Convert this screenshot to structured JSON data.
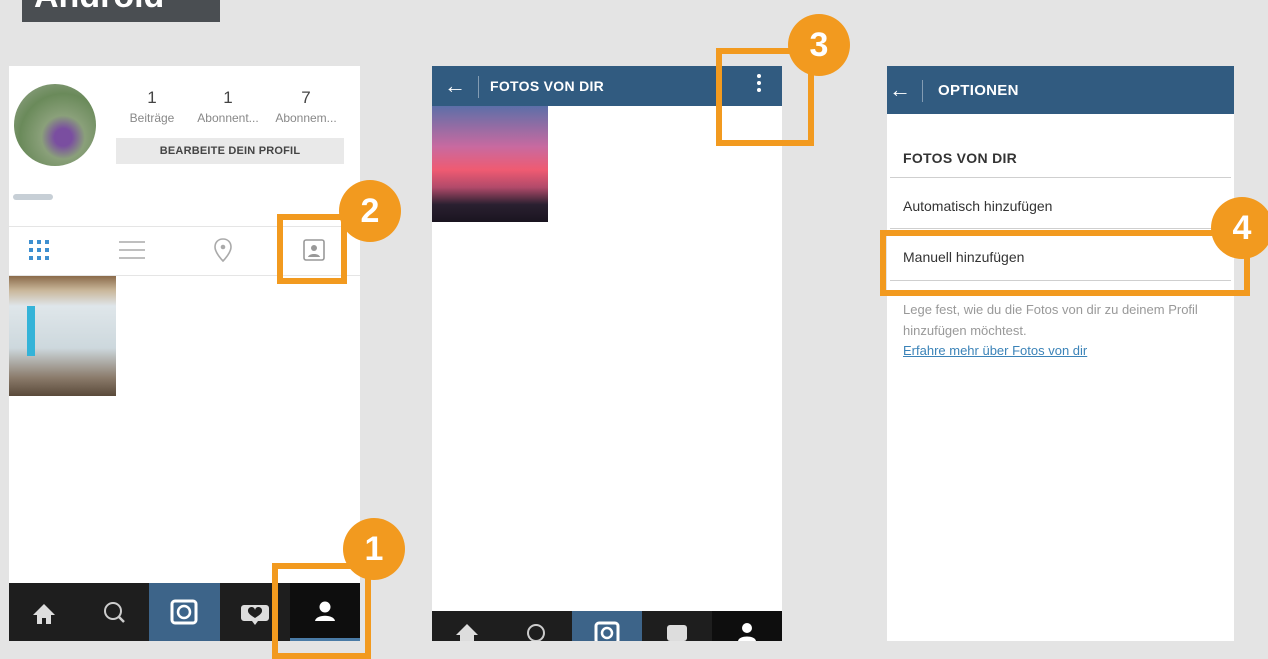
{
  "title": "Android",
  "profile": {
    "stats": [
      {
        "num": "1",
        "label": "Beiträge"
      },
      {
        "num": "1",
        "label": "Abonnent..."
      },
      {
        "num": "7",
        "label": "Abonnem..."
      }
    ],
    "edit_button": "BEARBEITE DEIN PROFIL"
  },
  "photos_screen": {
    "title": "FOTOS VON DIR"
  },
  "options_screen": {
    "title": "OPTIONEN",
    "section_title": "FOTOS VON DIR",
    "option_auto": "Automatisch hinzufügen",
    "option_manual": "Manuell hinzufügen",
    "description": "Lege fest, wie du die Fotos von dir zu deinem Profil hinzufügen möchtest.",
    "link": "Erfahre mehr über Fotos von dir"
  },
  "steps": [
    "1",
    "2",
    "3",
    "4"
  ],
  "colors": {
    "accent": "#f29a1f",
    "header": "#315b80"
  }
}
